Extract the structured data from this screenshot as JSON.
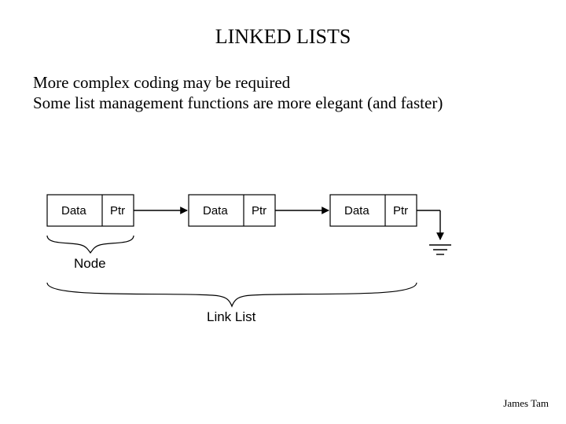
{
  "title": "LINKED LISTS",
  "lines": {
    "l1": "More complex coding may be required",
    "l2": "Some list management functions are more elegant (and faster)"
  },
  "node_cells": {
    "data": "Data",
    "ptr": "Ptr"
  },
  "labels": {
    "node": "Node",
    "linklist": "Link List"
  },
  "footer": "James Tam"
}
